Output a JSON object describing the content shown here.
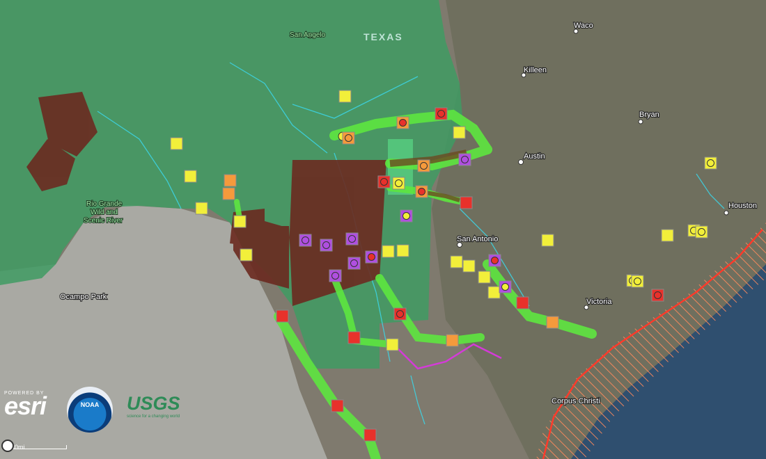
{
  "map": {
    "state_label": "TEXAS",
    "cities": [
      {
        "name": "Waco"
      },
      {
        "name": "Killeen"
      },
      {
        "name": "Bryan"
      },
      {
        "name": "Austin"
      },
      {
        "name": "Houston"
      },
      {
        "name": "San Antonio"
      },
      {
        "name": "Victoria"
      },
      {
        "name": "Corpus Christi"
      }
    ],
    "place_labels": {
      "san_angelo": "San Angelo",
      "ocampo_park": "Ocampo Park",
      "rio_grande_1": "Rio Grande",
      "rio_grande_2": "Wild and",
      "rio_grande_3": "Scenic River"
    },
    "legend_colors": {
      "yellow": "#f2ef3a",
      "orange": "#f59a3c",
      "red": "#e8312b",
      "purple": "#b04fe0",
      "green_corridor": "#5ee640",
      "brown_area": "#6b2a20"
    }
  },
  "attribution": {
    "esri_powered": "POWERED BY",
    "esri_name": "esri",
    "noaa": "NOAA",
    "usgs_name": "USGS",
    "usgs_sub": "science for a changing world"
  },
  "scale": {
    "label": "30mi"
  }
}
